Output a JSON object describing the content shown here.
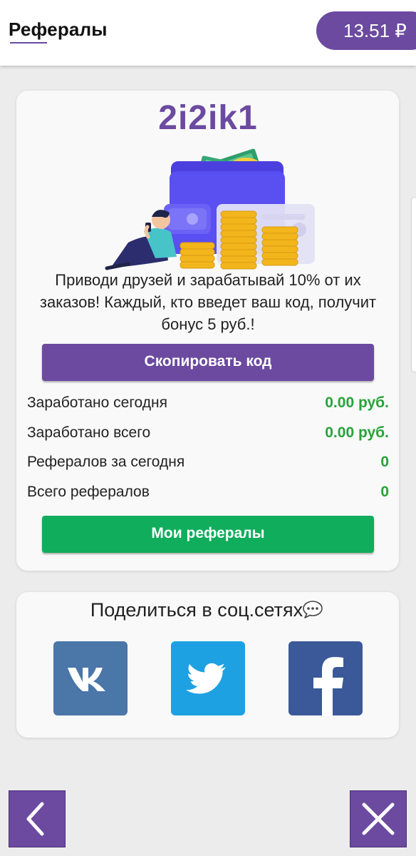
{
  "header": {
    "title": "Рефералы",
    "balance": "13.51 ₽"
  },
  "referral": {
    "code": "2i2ik1",
    "promo_text": "Приводи друзей и зарабатывай 10% от их заказов! Каждый, кто введет ваш код, получит бонус 5 руб.!",
    "copy_button_label": "Скопировать код",
    "stats": [
      {
        "label": "Заработано сегодня",
        "value": "0.00 руб."
      },
      {
        "label": "Заработано всего",
        "value": "0.00 руб."
      },
      {
        "label": "Рефералов за сегодня",
        "value": "0"
      },
      {
        "label": "Всего рефералов",
        "value": "0"
      }
    ],
    "my_referrals_button_label": "Мои рефералы"
  },
  "share": {
    "title": "Поделиться в соц.сетях",
    "networks": [
      {
        "icon": "vk-icon",
        "color": "#4a76a8"
      },
      {
        "icon": "twitter-icon",
        "color": "#1da1e2"
      },
      {
        "icon": "facebook-icon",
        "color": "#3b5998"
      }
    ]
  },
  "nav": {
    "back_icon": "chevron-left-icon",
    "close_icon": "close-icon"
  },
  "colors": {
    "accent": "#6b4aa0",
    "success": "#10ad5c",
    "value_text": "#27a33a"
  }
}
